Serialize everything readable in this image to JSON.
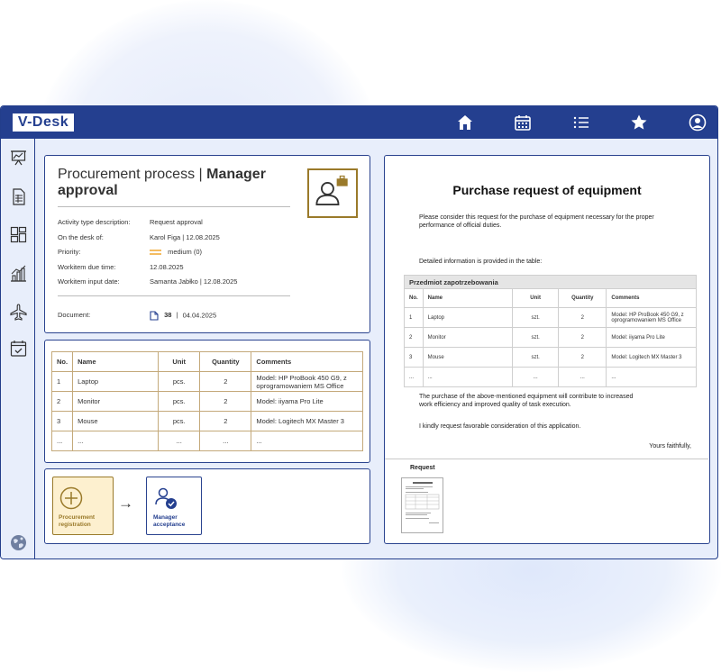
{
  "app": {
    "logo": "V-Desk"
  },
  "topbar": {
    "icons": [
      "home-icon",
      "calendar-icon",
      "list-icon",
      "star-icon",
      "user-icon"
    ]
  },
  "sidebar": {
    "icons": [
      "presentation-icon",
      "document-list-icon",
      "dashboard-icon",
      "bar-chart-icon",
      "airplane-icon",
      "calendar-check-icon",
      "globe-icon"
    ]
  },
  "process": {
    "title_prefix": "Procurement process |",
    "title_bold": "Manager approval",
    "fields": [
      {
        "label": "Activity type description:",
        "value": "Request approval"
      },
      {
        "label": "On the desk of:",
        "value": "Karol Figa  |  12.08.2025"
      },
      {
        "label": "Priority:",
        "value": "medium (0)"
      },
      {
        "label": "Workitem due time:",
        "value": "12.08.2025"
      },
      {
        "label": "Workitem input date:",
        "value": "Samanta Jabłko   |  12.08.2025"
      }
    ],
    "document": {
      "label": "Document:",
      "number": "38",
      "date": "04.04.2025"
    }
  },
  "items_table": {
    "headers": [
      "No.",
      "Name",
      "Unit",
      "Quantity",
      "Comments"
    ],
    "rows": [
      [
        "1",
        "Laptop",
        "pcs.",
        "2",
        "Model: HP ProBook 450 G9, z oprogramowaniem MS Office"
      ],
      [
        "2",
        "Monitor",
        "pcs.",
        "2",
        "Model: iiyama Pro Lite"
      ],
      [
        "3",
        "Mouse",
        "pcs.",
        "2",
        "Model: Logitech MX Master 3"
      ],
      [
        "...",
        "...",
        "...",
        "...",
        "..."
      ]
    ]
  },
  "workflow": {
    "step1": "Procurement registration",
    "step2": "Manager acceptance",
    "arrow": "→"
  },
  "document_view": {
    "title": "Purchase request of equipment",
    "intro": "Please consider this request for the purchase of equipment necessary for the proper performance of official duties.",
    "detail": "Detailed information is provided in the table:",
    "table_title": "Przedmiot zapotrzebowania",
    "headers": [
      "No.",
      "Name",
      "Unit",
      "Quantity",
      "Comments"
    ],
    "rows": [
      [
        "1",
        "Laptop",
        "szt.",
        "2",
        "Model: HP ProBook 450 G9, z oprogramowaniem MS Office"
      ],
      [
        "2",
        "Monitor",
        "szt.",
        "2",
        "Model: iiyama Pro Lite"
      ],
      [
        "3",
        "Mouse",
        "szt.",
        "2",
        "Model: Logitech MX Master 3"
      ],
      [
        "...",
        "...",
        "...",
        "...",
        "..."
      ]
    ],
    "closing1": "The purchase of the above-mentioned equipment will contribute to increased work efficiency and improved quality of task execution.",
    "closing2": "I kindly request favorable consideration of this application.",
    "signoff": "Yours faithfully,",
    "attachment_label": "Request"
  },
  "colors": {
    "brand": "#243f8f",
    "accent_gold": "#9a7a2a",
    "step_fill": "#fdf0cf",
    "priority": "#f0a020"
  }
}
